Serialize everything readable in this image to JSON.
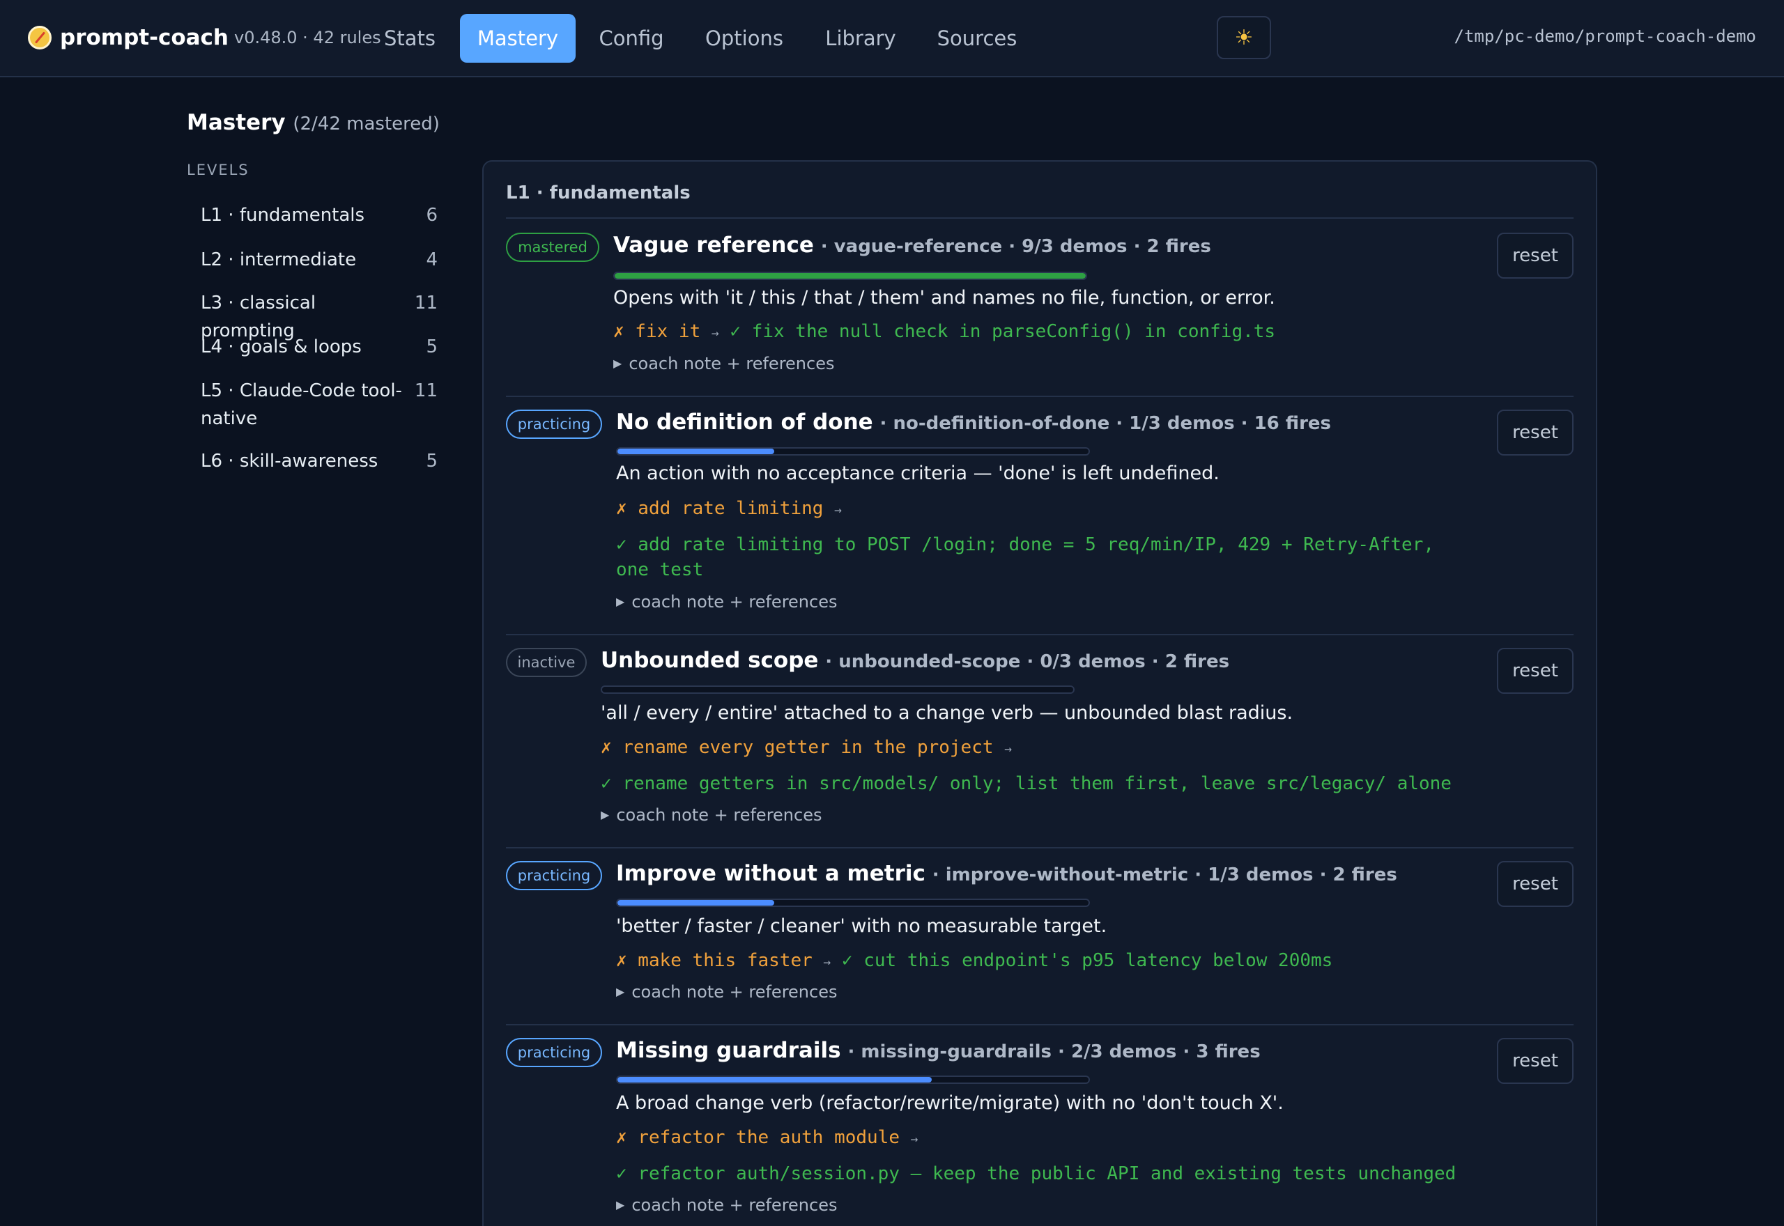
{
  "app": {
    "name": "prompt-coach",
    "version_info": "v0.48.0 · 42 rules",
    "theme_icon": "sun-icon",
    "path": "/tmp/pc-demo/prompt-coach-demo"
  },
  "nav": {
    "tabs": [
      {
        "label": "Stats"
      },
      {
        "label": "Mastery",
        "active": true
      },
      {
        "label": "Config"
      },
      {
        "label": "Options"
      },
      {
        "label": "Library"
      },
      {
        "label": "Sources"
      }
    ]
  },
  "page": {
    "title": "Mastery",
    "subtitle": "(2/42 mastered)",
    "levels_heading": "LEVELS"
  },
  "levels": [
    {
      "name": "L1 · fundamentals",
      "count": "6"
    },
    {
      "name": "L2 · intermediate",
      "count": "4"
    },
    {
      "name": "L3 · classical prompting",
      "count": "11"
    },
    {
      "name": "L4 · goals & loops",
      "count": "5"
    },
    {
      "name": "L5 · Claude-Code tool-native",
      "count": "11"
    },
    {
      "name": "L6 · skill-awareness",
      "count": "5"
    }
  ],
  "section": {
    "title": "L1 · fundamentals"
  },
  "rules": [
    {
      "status": "mastered",
      "title": "Vague reference",
      "meta": "· vague-reference · 9/3 demos · 2 fires",
      "progress": 1.0,
      "description": "Opens with 'it / this / that / them' and names no file, function, or error.",
      "bad": "✗ fix it",
      "good": "✓ fix the null check in parseConfig() in config.ts",
      "coach": "coach note + references",
      "reset": "reset"
    },
    {
      "status": "practicing",
      "title": "No definition of done",
      "meta": "· no-definition-of-done · 1/3 demos · 16 fires",
      "progress": 0.333,
      "description": "An action with no acceptance criteria — 'done' is left undefined.",
      "bad": "✗ add rate limiting",
      "good": "✓ add rate limiting to POST /login; done = 5 req/min/IP, 429 + Retry-After, one test",
      "coach": "coach note + references",
      "reset": "reset"
    },
    {
      "status": "inactive",
      "title": "Unbounded scope",
      "meta": "· unbounded-scope · 0/3 demos · 2 fires",
      "progress": 0,
      "description": "'all / every / entire' attached to a change verb — unbounded blast radius.",
      "bad": "✗ rename every getter in the project",
      "good": "✓ rename getters in src/models/ only; list them first, leave src/legacy/ alone",
      "coach": "coach note + references",
      "reset": "reset"
    },
    {
      "status": "practicing",
      "title": "Improve without a metric",
      "meta": "· improve-without-metric · 1/3 demos · 2 fires",
      "progress": 0.333,
      "description": "'better / faster / cleaner' with no measurable target.",
      "bad": "✗ make this faster",
      "good": "✓ cut this endpoint's p95 latency below 200ms",
      "coach": "coach note + references",
      "reset": "reset"
    },
    {
      "status": "practicing",
      "title": "Missing guardrails",
      "meta": "· missing-guardrails · 2/3 demos · 3 fires",
      "progress": 0.667,
      "description": "A broad change verb (refactor/rewrite/migrate) with no 'don't touch X'.",
      "bad": "✗ refactor the auth module",
      "good": "✓ refactor auth/session.py — keep the public API and existing tests unchanged",
      "coach": "coach note + references",
      "reset": "reset"
    }
  ]
}
